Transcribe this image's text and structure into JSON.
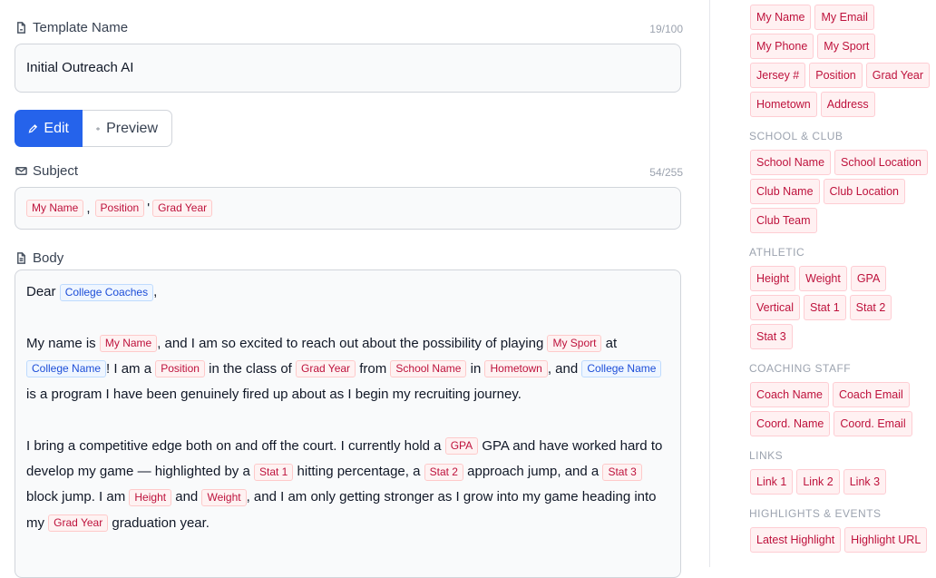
{
  "template_name": {
    "label": "Template Name",
    "counter": "19/100",
    "value": "Initial Outreach AI"
  },
  "tabs": {
    "edit_label": "Edit",
    "preview_label": "Preview"
  },
  "subject": {
    "label": "Subject",
    "counter": "54/255",
    "chips": [
      "My Name",
      "Position",
      "Grad Year"
    ],
    "sep1": ",",
    "sep2": "'"
  },
  "body": {
    "label": "Body",
    "p1": {
      "t0": "Dear",
      "c0": "College Coaches",
      "t1": ","
    },
    "p2": {
      "t0": "My name is",
      "c0": "My Name",
      "t1": ", and I am so excited to reach out about the possibility of playing",
      "c1": "My Sport",
      "t2": "at",
      "c2": "College Name",
      "t3": "! I am a",
      "c3": "Position",
      "t4": "in the class of",
      "c4": "Grad Year",
      "t5": "from",
      "c5": "School Name",
      "t6": "in",
      "c6": "Hometown",
      "t7": ", and",
      "c7": "College Name",
      "t8": "is a program I have been genuinely fired up about as I begin my recruiting journey."
    },
    "p3": {
      "t0": "I bring a competitive edge both on and off the court. I currently hold a",
      "c0": "GPA",
      "t1": "GPA and have worked hard to develop my game — highlighted by a",
      "c1": "Stat 1",
      "t2": "hitting percentage, a",
      "c2": "Stat 2",
      "t3": "approach jump, and a",
      "c3": "Stat 3",
      "t4": "block jump. I am",
      "c4": "Height",
      "t5": "and",
      "c5": "Weight",
      "t6": ", and I am only getting stronger as I grow into my game heading into my",
      "c6": "Grad Year",
      "t7": "graduation year."
    }
  },
  "sidebar": {
    "personal": [
      "My Name",
      "My Email",
      "My Phone",
      "My Sport",
      "Jersey #",
      "Position",
      "Grad Year",
      "Hometown",
      "Address"
    ],
    "school_title": "SCHOOL & CLUB",
    "school": [
      "School Name",
      "School Location",
      "Club Name",
      "Club Location",
      "Club Team"
    ],
    "athletic_title": "ATHLETIC",
    "athletic": [
      "Height",
      "Weight",
      "GPA",
      "Vertical",
      "Stat 1",
      "Stat 2",
      "Stat 3"
    ],
    "coaching_title": "COACHING STAFF",
    "coaching": [
      "Coach Name",
      "Coach Email",
      "Coord. Name",
      "Coord. Email"
    ],
    "links_title": "LINKS",
    "links": [
      "Link 1",
      "Link 2",
      "Link 3"
    ],
    "highlights_title": "HIGHLIGHTS & EVENTS",
    "highlights": [
      "Latest Highlight",
      "Highlight URL"
    ]
  }
}
